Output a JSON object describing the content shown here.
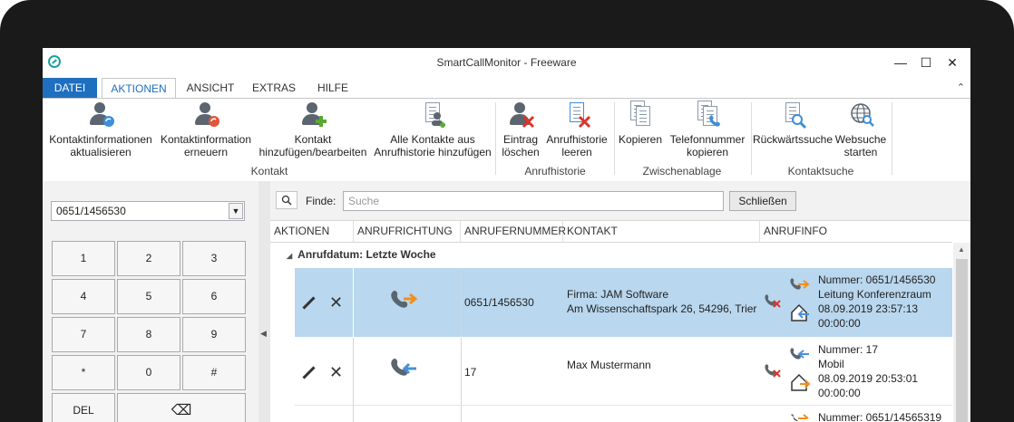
{
  "window": {
    "title": "SmartCallMonitor - Freeware",
    "minimize": "—",
    "maximize": "☐",
    "close": "✕"
  },
  "tabs": [
    "DATEI",
    "AKTIONEN",
    "ANSICHT",
    "EXTRAS",
    "HILFE"
  ],
  "ribbon": {
    "collapse": "⌃",
    "buttons": [
      {
        "l1": "Kontaktinformationen",
        "l2": "aktualisieren",
        "icon": "person-refresh-icon"
      },
      {
        "l1": "Kontaktinformation",
        "l2": "erneuern",
        "icon": "person-renew-icon"
      },
      {
        "l1": "Kontakt",
        "l2": "hinzufügen/bearbeiten",
        "icon": "person-add-icon"
      },
      {
        "l1": "Alle Kontakte aus",
        "l2": "Anrufhistorie hinzufügen",
        "icon": "add-all-contacts-icon"
      },
      {
        "l1": "Eintrag",
        "l2": "löschen",
        "icon": "delete-entry-icon"
      },
      {
        "l1": "Anrufhistorie",
        "l2": "leeren",
        "icon": "clear-history-icon"
      },
      {
        "l1": "Kopieren",
        "l2": "",
        "icon": "copy-icon"
      },
      {
        "l1": "Telefonnummer",
        "l2": "kopieren",
        "icon": "copy-number-icon"
      },
      {
        "l1": "Rückwärtssuche",
        "l2": "",
        "icon": "reverse-search-icon"
      },
      {
        "l1": "Websuche",
        "l2": "starten",
        "icon": "web-search-icon"
      }
    ],
    "groups": [
      "Kontakt",
      "Anrufhistorie",
      "Zwischenablage",
      "Kontaktsuche"
    ]
  },
  "dialer": {
    "number": "0651/1456530",
    "keys": [
      "1",
      "2",
      "3",
      "4",
      "5",
      "6",
      "7",
      "8",
      "9",
      "*",
      "0",
      "#",
      "DEL",
      "⌫"
    ]
  },
  "find": {
    "icon": "search-icon",
    "label": "Finde:",
    "placeholder": "Suche",
    "close": "Schließen"
  },
  "table": {
    "headers": [
      "AKTIONEN",
      "ANRUFRICHTUNG",
      "ANRUFERNUMMER",
      "KONTAKT",
      "ANRUFINFO"
    ],
    "group": "Anrufdatum: Letzte Woche",
    "rows": [
      {
        "direction": "outgoing",
        "number": "0651/1456530",
        "contact1": "Firma: JAM Software",
        "contact2": "Am Wissenschaftspark 26, 54296, Trier",
        "info": [
          "Nummer: 0651/1456530",
          "Leitung Konferenzraum",
          "08.09.2019 23:57:13",
          "00:00:00"
        ]
      },
      {
        "direction": "incoming",
        "number": "17",
        "contact1": "Max Mustermann",
        "contact2": "",
        "info": [
          "Nummer: 17",
          "Mobil",
          "08.09.2019 20:53:01",
          "00:00:00"
        ]
      },
      {
        "direction": "outgoing",
        "number": "",
        "contact1": "",
        "contact2": "",
        "info": [
          "Nummer: 0651/14565319"
        ]
      }
    ]
  },
  "colors": {
    "accent": "#1e6fc0",
    "selected": "#b9d7ee",
    "outgoing": "#f0901e",
    "incoming": "#4a90d9",
    "missed": "#d9342b"
  }
}
